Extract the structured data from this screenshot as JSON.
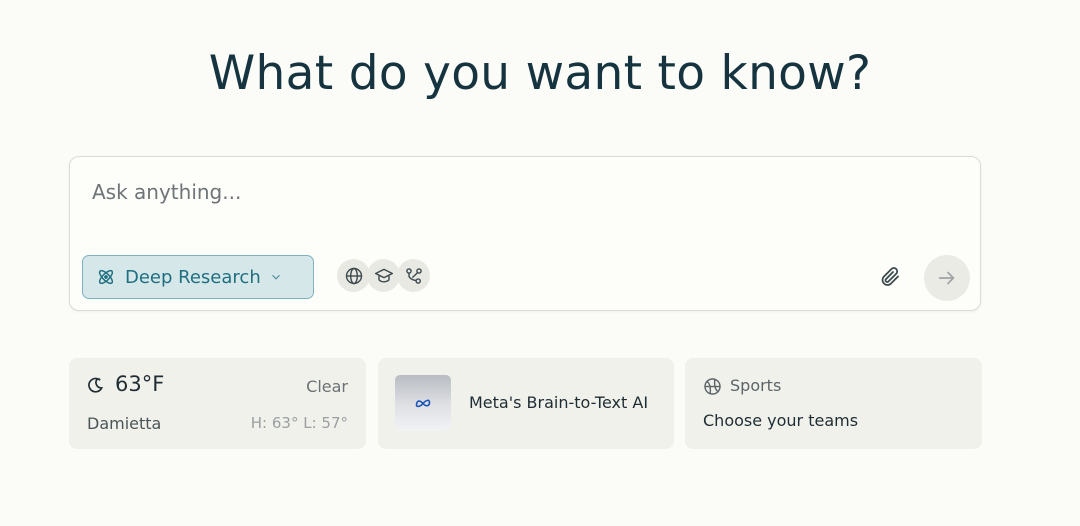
{
  "headline": "What do you want to know?",
  "search": {
    "placeholder": "Ask anything...",
    "value": ""
  },
  "mode": {
    "label": "Deep Research",
    "icon": "atom-icon"
  },
  "tools": [
    {
      "icon": "globe-icon"
    },
    {
      "icon": "graduation-cap-icon"
    },
    {
      "icon": "network-icon"
    }
  ],
  "actions": {
    "attach_icon": "paperclip-icon",
    "submit_icon": "arrow-right-icon"
  },
  "weather": {
    "icon": "moon-icon",
    "temp": "63°F",
    "condition": "Clear",
    "city": "Damietta",
    "high_low": "H: 63° L: 57°"
  },
  "news": {
    "thumb_icon": "meta-logo-icon",
    "title": "Meta's Brain-to-Text AI"
  },
  "sports": {
    "icon": "basketball-icon",
    "label": "Sports",
    "subtitle": "Choose your teams"
  },
  "colors": {
    "background": "#fbfbf7",
    "accent": "#1f6f80",
    "accent_bg": "#d6e7ea",
    "card_bg": "#f1f1ec"
  }
}
